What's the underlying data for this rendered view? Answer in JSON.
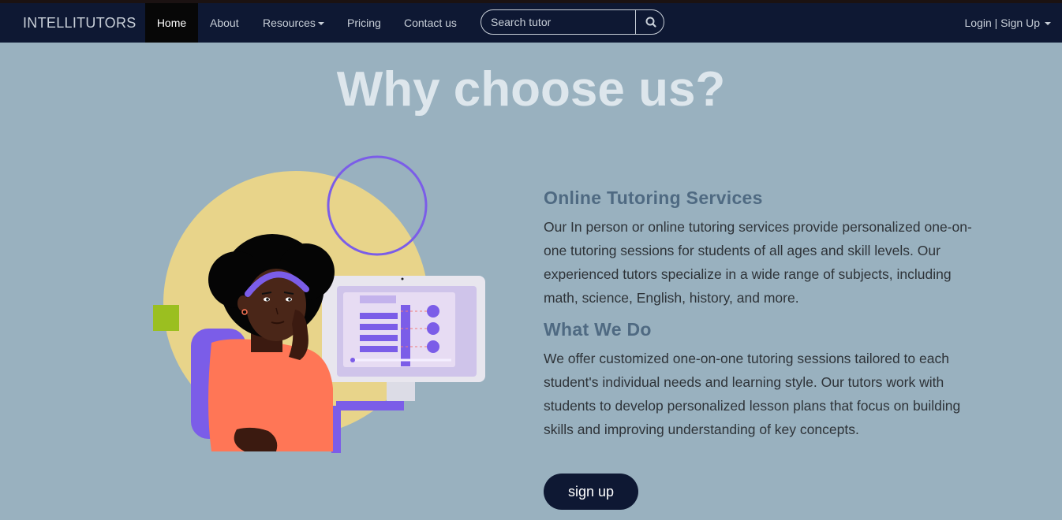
{
  "navbar": {
    "brand": "INTELLITUTORS",
    "items": [
      {
        "label": "Home",
        "active": true
      },
      {
        "label": "About"
      },
      {
        "label": "Resources",
        "dropdown": true
      },
      {
        "label": "Pricing"
      },
      {
        "label": "Contact us"
      }
    ],
    "search": {
      "placeholder": "Search tutor",
      "icon": "search-icon"
    },
    "account": {
      "label": "Login | Sign Up",
      "dropdown": true
    }
  },
  "hero": {
    "title": "Why choose us?"
  },
  "sections": [
    {
      "heading": "Online Tutoring Services",
      "text": "Our In person or online tutoring services provide personalized one-on-one tutoring sessions for students of all ages and skill levels. Our experienced tutors specialize in a wide range of subjects, including math, science, English, history, and more."
    },
    {
      "heading": "What We Do",
      "text": "We offer customized one-on-one tutoring sessions tailored to each student's individual needs and learning style. Our tutors work with students to develop personalized lesson plans that focus on building skills and improving understanding of key concepts."
    }
  ],
  "cta": {
    "label": "sign up"
  },
  "colors": {
    "navbar_bg": "#0e1833",
    "page_bg": "#99b1bf",
    "heading": "#4f6a82",
    "accent_purple": "#7b5de8",
    "accent_yellow": "#e8d48a",
    "accent_orange": "#ff7656"
  }
}
